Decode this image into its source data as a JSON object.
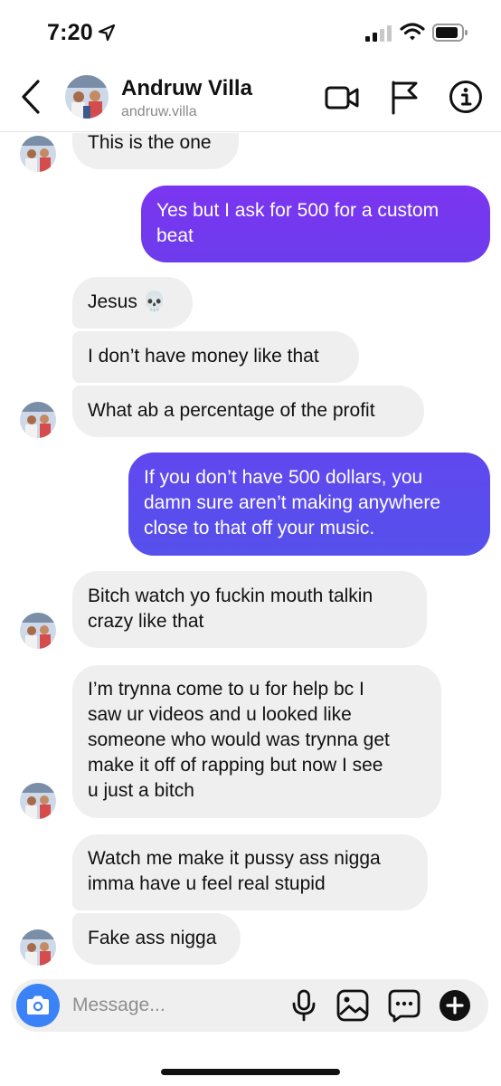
{
  "status_bar": {
    "time": "7:20"
  },
  "header": {
    "name": "Andruw Villa",
    "handle": "andruw.villa"
  },
  "messages": [
    {
      "sender": "them",
      "lines": [
        "This is the one"
      ]
    },
    {
      "sender": "me",
      "lines": [
        "Yes but I ask for 500 for a custom",
        "beat"
      ]
    },
    {
      "sender": "them",
      "lines": [
        "Jesus 💀"
      ]
    },
    {
      "sender": "them",
      "lines": [
        "I don’t have money like that"
      ]
    },
    {
      "sender": "them",
      "lines": [
        "What ab a percentage of the profit"
      ]
    },
    {
      "sender": "me",
      "lines": [
        "If you don’t have 500 dollars, you",
        "damn sure aren’t making anywhere",
        "close to that off your music."
      ]
    },
    {
      "sender": "them",
      "lines": [
        "Bitch watch yo fuckin mouth talkin",
        "crazy like that"
      ]
    },
    {
      "sender": "them",
      "lines": [
        "I’m trynna come to u for help bc I",
        "saw ur videos and u looked like",
        "someone who would was trynna get",
        "make it off of rapping but now I see",
        "u just a bitch"
      ]
    },
    {
      "sender": "them",
      "lines": [
        "Watch me make it pussy ass nigga",
        "imma have u feel real stupid"
      ]
    },
    {
      "sender": "them",
      "lines": [
        "Fake ass nigga"
      ]
    }
  ],
  "composer": {
    "placeholder": "Message..."
  },
  "colors": {
    "outgoing_top": "#7c3aed",
    "outgoing_bottom": "#5850ec",
    "incoming": "#efefef",
    "camera_button": "#3b82f6"
  }
}
